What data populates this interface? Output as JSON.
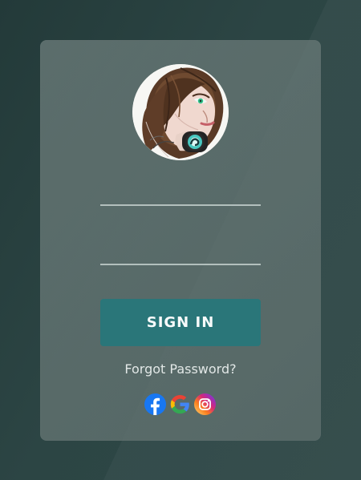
{
  "card": {
    "avatar_alt": "",
    "username_value": "",
    "password_value": "",
    "username_placeholder": "",
    "password_placeholder": "",
    "signin_label": "SIGN IN",
    "forgot_password": "Forgot Password?"
  },
  "socials": [
    {
      "name": "facebook-icon"
    },
    {
      "name": "google-icon"
    },
    {
      "name": "instagram-icon"
    }
  ],
  "colors": {
    "background": "#2a4241",
    "card": "#667674",
    "button": "#2a7679",
    "text": "#f1f5f4"
  }
}
